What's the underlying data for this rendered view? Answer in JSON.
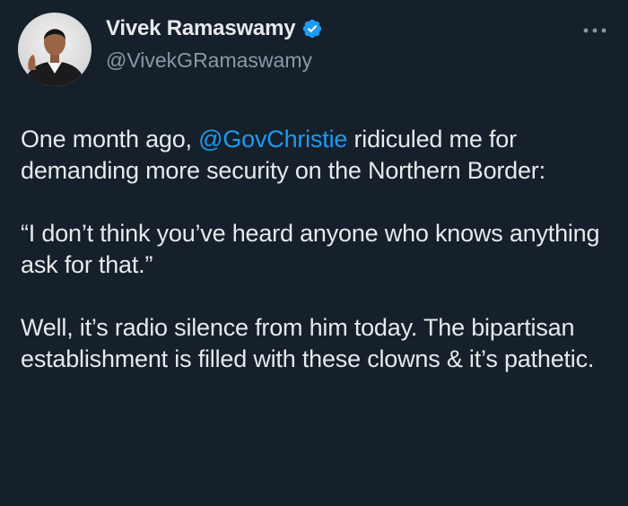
{
  "author": {
    "display_name": "Vivek Ramaswamy",
    "handle": "@VivekGRamaswamy",
    "verified": true,
    "verified_icon": "verified-badge-icon",
    "avatar_icon": "profile-photo"
  },
  "menu": {
    "icon": "more-options-icon"
  },
  "tweet": {
    "p1_before": "One month ago, ",
    "p1_mention": "@GovChristie",
    "p1_after": " ridiculed me for demanding more security on the Northern Border:",
    "p2": "“I don’t think you’ve heard anyone who knows anything ask for that.”",
    "p3": "Well, it’s radio silence from him today. The bipartisan establishment is filled with these clowns & it’s pathetic."
  },
  "colors": {
    "background": "#15202b",
    "text": "#e7e9ea",
    "secondary_text": "#8b98a5",
    "accent": "#1d9bf0"
  }
}
